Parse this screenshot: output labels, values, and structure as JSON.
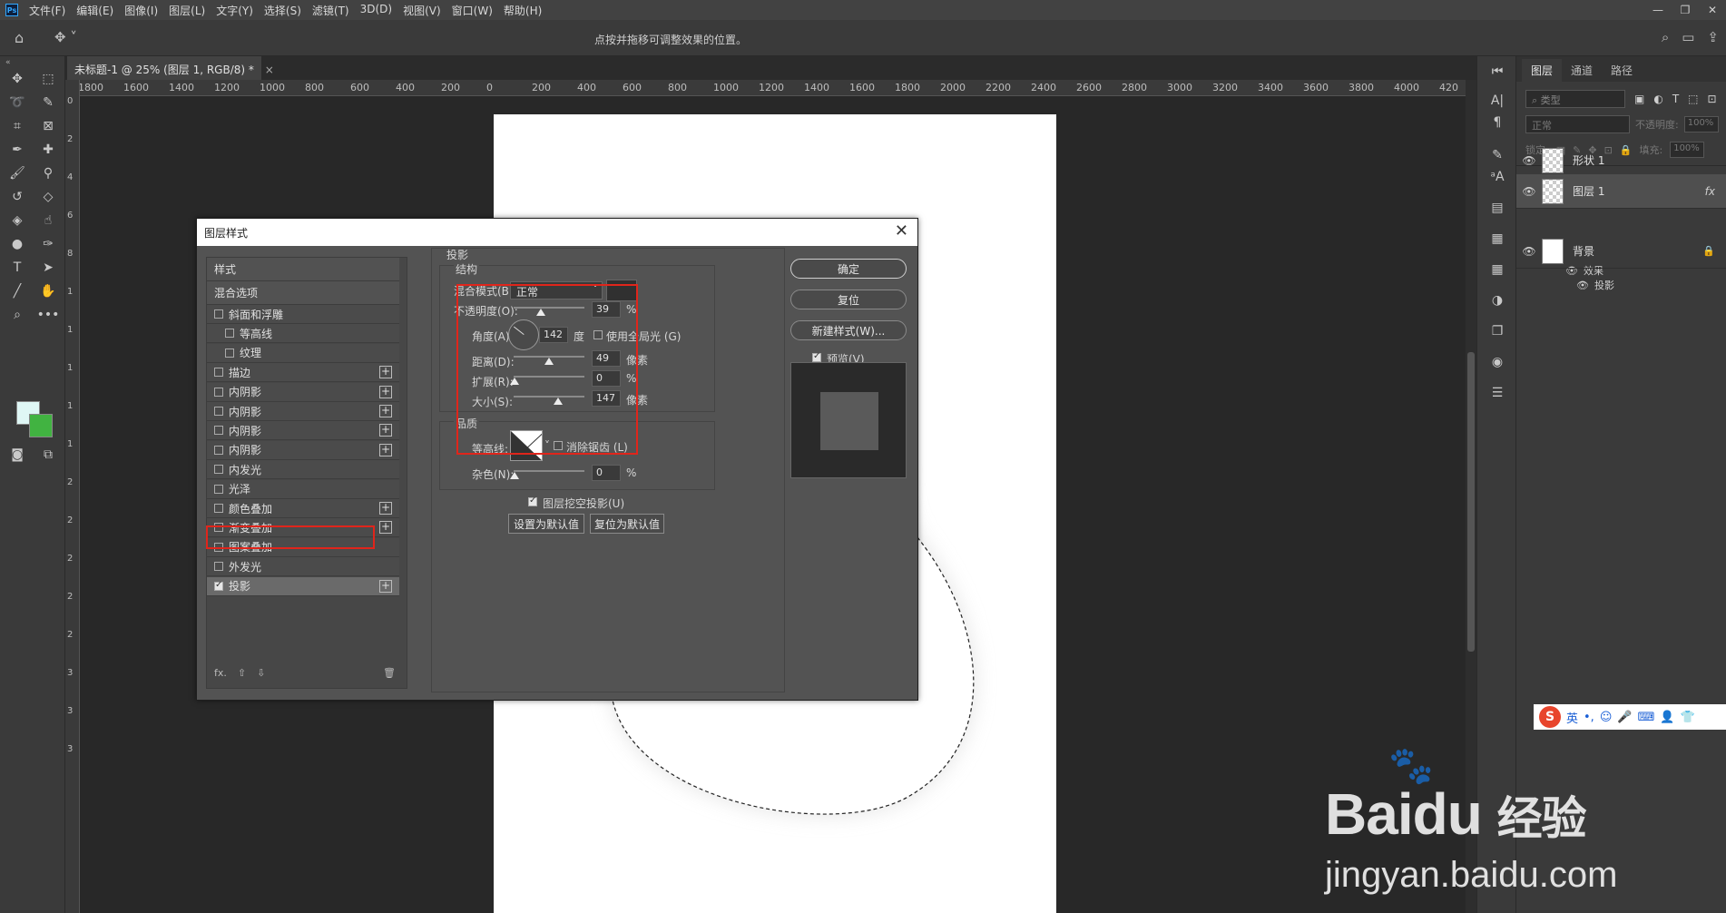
{
  "menubar": {
    "logo": "Ps",
    "items": [
      "文件(F)",
      "编辑(E)",
      "图像(I)",
      "图层(L)",
      "文字(Y)",
      "选择(S)",
      "滤镜(T)",
      "3D(D)",
      "视图(V)",
      "窗口(W)",
      "帮助(H)"
    ]
  },
  "options": {
    "hint": "点按并拖移可调整效果的位置。"
  },
  "document": {
    "tab_title": "未标题-1 @ 25% (图层 1, RGB/8) *",
    "close": "×"
  },
  "ruler": {
    "h": [
      "1800",
      "1600",
      "1400",
      "1200",
      "1000",
      "800",
      "600",
      "400",
      "200",
      "0",
      "200",
      "400",
      "600",
      "800",
      "1000",
      "1200",
      "1400",
      "1600",
      "1800",
      "2000",
      "2200",
      "2400",
      "2600",
      "2800",
      "3000",
      "3200",
      "3400",
      "3600",
      "3800",
      "4000",
      "420"
    ],
    "v": [
      "0",
      "2",
      "4",
      "6",
      "8",
      "1",
      "1",
      "1",
      "1",
      "1",
      "2",
      "2",
      "2",
      "2",
      "2",
      "3",
      "3",
      "3"
    ]
  },
  "layers_panel": {
    "tabs": [
      "图层",
      "通道",
      "路径"
    ],
    "kind_placeholder": "类型",
    "blend_mode": "正常",
    "opacity_label": "不透明度:",
    "opacity_value": "100%",
    "lock_label": "锁定:",
    "fill_label": "填充:",
    "fill_value": "100%",
    "layers": [
      {
        "name": "形状 1"
      },
      {
        "name": "图层 1",
        "fx": "fx"
      },
      {
        "name": "背景"
      }
    ],
    "effects_label": "效果",
    "effect_name": "投影"
  },
  "ime_bar": {
    "logo": "S",
    "lang": "英"
  },
  "dialog": {
    "title": "图层样式",
    "styles_header": "样式",
    "blend_options": "混合选项",
    "items": [
      {
        "label": "斜面和浮雕",
        "checked": false,
        "plus": false,
        "indent": false
      },
      {
        "label": "等高线",
        "checked": false,
        "plus": false,
        "indent": true
      },
      {
        "label": "纹理",
        "checked": false,
        "plus": false,
        "indent": true
      },
      {
        "label": "描边",
        "checked": false,
        "plus": true,
        "indent": false
      },
      {
        "label": "内阴影",
        "checked": false,
        "plus": true,
        "indent": false
      },
      {
        "label": "内阴影",
        "checked": false,
        "plus": true,
        "indent": false
      },
      {
        "label": "内阴影",
        "checked": false,
        "plus": true,
        "indent": false
      },
      {
        "label": "内阴影",
        "checked": false,
        "plus": true,
        "indent": false
      },
      {
        "label": "内发光",
        "checked": false,
        "plus": false,
        "indent": false
      },
      {
        "label": "光泽",
        "checked": false,
        "plus": false,
        "indent": false
      },
      {
        "label": "颜色叠加",
        "checked": false,
        "plus": true,
        "indent": false
      },
      {
        "label": "渐变叠加",
        "checked": false,
        "plus": true,
        "indent": false
      },
      {
        "label": "图案叠加",
        "checked": false,
        "plus": false,
        "indent": false
      },
      {
        "label": "外发光",
        "checked": false,
        "plus": false,
        "indent": false
      },
      {
        "label": "投影",
        "checked": true,
        "plus": true,
        "indent": false
      }
    ],
    "section_title": "投影",
    "structure_title": "结构",
    "blend_mode_label": "混合模式(B):",
    "blend_mode_value": "正常",
    "opacity_label": "不透明度(O):",
    "opacity_value": "39",
    "opacity_level": 0.39,
    "percent": "%",
    "angle_label": "角度(A):",
    "angle_value": "142",
    "angle_unit": "度",
    "global_light_label": "使用全局光 (G)",
    "distance_label": "距离(D):",
    "distance_value": "49",
    "pixel_unit": "像素",
    "spread_label": "扩展(R):",
    "spread_value": "0",
    "size_label": "大小(S):",
    "size_value": "147",
    "quality_title": "品质",
    "contour_label": "等高线:",
    "antialias_label": "消除锯齿 (L)",
    "noise_label": "杂色(N):",
    "noise_value": "0",
    "knockout_label": "图层挖空投影(U)",
    "make_default": "设置为默认值",
    "reset_default": "复位为默认值",
    "ok": "确定",
    "reset": "复位",
    "new_style": "新建样式(W)...",
    "preview_label": "预览(V)",
    "fx_label": "fx."
  },
  "colors": {
    "accent_red": "#e0251b",
    "foreground": "#dff7f5",
    "background": "#41b341"
  },
  "watermark": {
    "brand": "Bai",
    "suffix": "du",
    "cn": "经验",
    "url": "jingyan.baidu.com"
  }
}
